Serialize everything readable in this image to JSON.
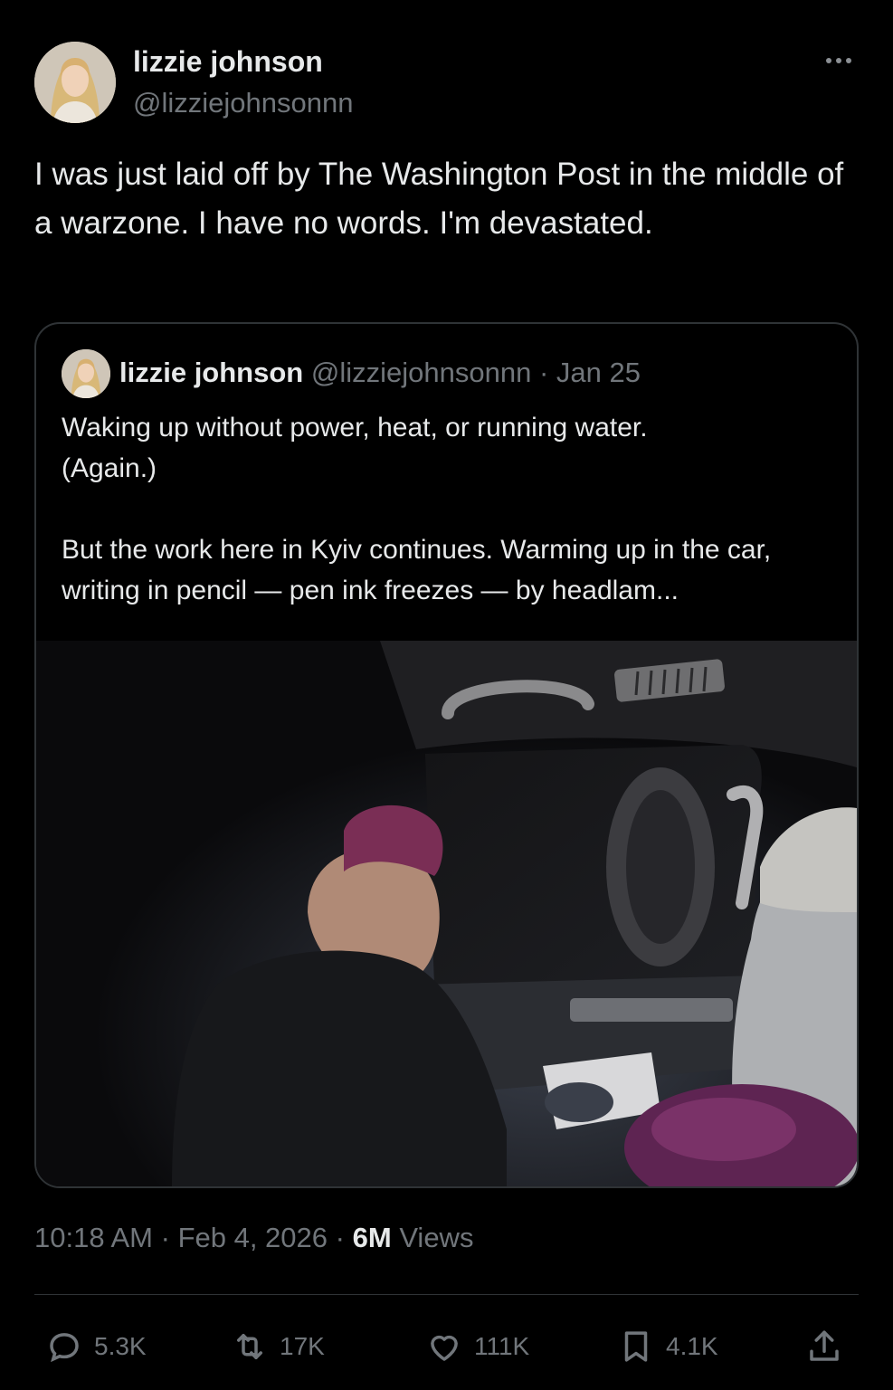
{
  "author": {
    "name": "lizzie johnson",
    "handle": "@lizziejohnsonnn"
  },
  "tweet": {
    "text": "I was just laid off by The Washington Post in the middle of a warzone. I have no words. I'm devastated."
  },
  "quoted": {
    "name": "lizzie johnson",
    "handle": "@lizziejohnsonnn",
    "separator": "·",
    "date": "Jan 25",
    "line1": "Waking up without power, heat, or running water.",
    "line2": "(Again.)",
    "line3": "But the work here in Kyiv continues. Warming up in the car, writing in pencil — pen ink freezes — by headlam..."
  },
  "meta": {
    "time": "10:18 AM",
    "sep1": "·",
    "date": "Feb 4, 2026",
    "sep2": "·",
    "views_count": "6M",
    "views_label": "Views"
  },
  "actions": {
    "replies": "5.3K",
    "reposts": "17K",
    "likes": "111K",
    "bookmarks": "4.1K"
  },
  "icons": [
    "more-icon",
    "reply-icon",
    "repost-icon",
    "like-icon",
    "bookmark-icon",
    "share-icon"
  ],
  "colors": {
    "background": "#000000",
    "text": "#e7e9ea",
    "secondary": "#71767b",
    "border": "#2f3336"
  }
}
